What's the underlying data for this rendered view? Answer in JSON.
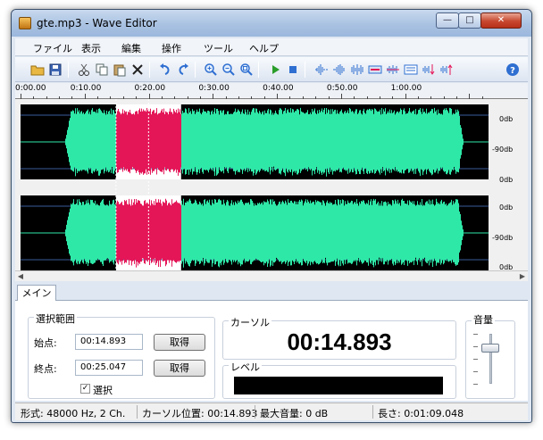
{
  "window": {
    "title": "gte.mp3 - Wave Editor",
    "close_glyph": "✕",
    "min_glyph": "—",
    "max_glyph": "□"
  },
  "menu": {
    "items": [
      "ファイル",
      "表示",
      "編集",
      "操作",
      "ツール",
      "ヘルプ"
    ]
  },
  "toolbar": {
    "icons": [
      "folder-open-icon",
      "save-icon",
      "cut-icon",
      "copy-icon",
      "paste-icon",
      "delete-icon",
      "undo-icon",
      "redo-icon",
      "zoom-in-icon",
      "zoom-out-icon",
      "zoom-fit-icon",
      "play-icon",
      "stop-icon",
      "wave-effect-1-icon",
      "wave-effect-2-icon",
      "wave-effect-3-icon",
      "wave-effect-4-icon",
      "wave-effect-5-icon",
      "wave-effect-6-icon",
      "wave-effect-7-icon",
      "wave-effect-8-icon",
      "help-icon"
    ],
    "colors": {
      "accent_blue": "#2f6fd1",
      "play_green": "#2a9d2a",
      "delete_black": "#222222"
    }
  },
  "ruler": {
    "labels": [
      "0:00.00",
      "0:10.00",
      "0:20.00",
      "0:30.00",
      "0:40.00",
      "0:50.00",
      "1:00.00"
    ]
  },
  "waveform": {
    "db_labels": [
      "0db",
      "-90db",
      "0db",
      "0db",
      "-90db",
      "0db"
    ],
    "colors": {
      "background": "#000000",
      "wave": "#2ee8a8",
      "selection": "#e41658",
      "selection_bg": "#ffffff"
    },
    "total_seconds": 69.048,
    "visible_seconds": 73,
    "selection_start_seconds": 14.893,
    "selection_end_seconds": 25.047,
    "cursor_seconds": 14.893
  },
  "tabs": {
    "main": "メイン"
  },
  "selection": {
    "title": "選択範囲",
    "start_label": "始点:",
    "start_value": "00:14.893",
    "end_label": "終点:",
    "end_value": "00:25.047",
    "get_button": "取得",
    "select_label": "選択",
    "select_checked": "✓"
  },
  "cursor": {
    "title": "カーソル",
    "time": "00:14.893"
  },
  "level": {
    "title": "レベル"
  },
  "volume": {
    "title": "音量",
    "level": 0.82
  },
  "status": {
    "format": "形式: 48000 Hz, 2 Ch.",
    "cursor_position": "カーソル位置: 00:14.893",
    "max_volume": "最大音量: 0 dB",
    "length": "長さ: 0:01:09.048"
  }
}
